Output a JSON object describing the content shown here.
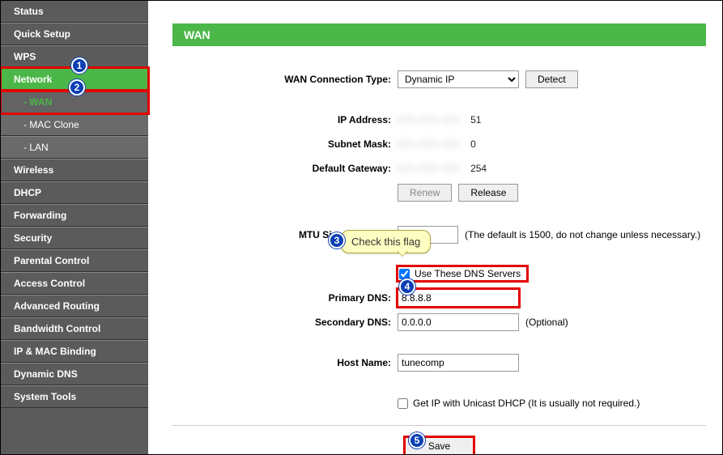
{
  "sidebar": {
    "items": [
      {
        "label": "Status"
      },
      {
        "label": "Quick Setup"
      },
      {
        "label": "WPS"
      },
      {
        "label": "Network",
        "active": true
      },
      {
        "label": "- WAN",
        "sub": true,
        "subactive": true
      },
      {
        "label": "- MAC Clone",
        "sub": true
      },
      {
        "label": "- LAN",
        "sub": true
      },
      {
        "label": "Wireless"
      },
      {
        "label": "DHCP"
      },
      {
        "label": "Forwarding"
      },
      {
        "label": "Security"
      },
      {
        "label": "Parental Control"
      },
      {
        "label": "Access Control"
      },
      {
        "label": "Advanced Routing"
      },
      {
        "label": "Bandwidth Control"
      },
      {
        "label": "IP & MAC Binding"
      },
      {
        "label": "Dynamic DNS"
      },
      {
        "label": "System Tools"
      }
    ]
  },
  "page": {
    "title": "WAN"
  },
  "wan": {
    "conn_type_label": "WAN Connection Type:",
    "conn_type_value": "Dynamic IP",
    "detect_label": "Detect",
    "ip_label": "IP Address:",
    "ip_suffix": "51",
    "mask_label": "Subnet Mask:",
    "mask_suffix": "0",
    "gw_label": "Default Gateway:",
    "gw_suffix": "254",
    "renew_label": "Renew",
    "release_label": "Release",
    "mtu_label": "MTU Size (in bytes):",
    "mtu_value": "1500",
    "mtu_hint": "(The default is 1500, do not change unless necessary.)",
    "use_dns_label": "Use These DNS Servers",
    "use_dns_checked": true,
    "pdns_label": "Primary DNS:",
    "pdns_value": "8.8.8.8",
    "sdns_label": "Secondary DNS:",
    "sdns_value": "0.0.0.0",
    "sdns_hint": "(Optional)",
    "host_label": "Host Name:",
    "host_value": "tunecomp",
    "unicast_label": "Get IP with Unicast DHCP (It is usually not required.)",
    "save_label": "Save"
  },
  "annotations": {
    "b1": "1",
    "b2": "2",
    "b3": "3",
    "b4": "4",
    "b5": "5",
    "callout3": "Check this flag"
  }
}
